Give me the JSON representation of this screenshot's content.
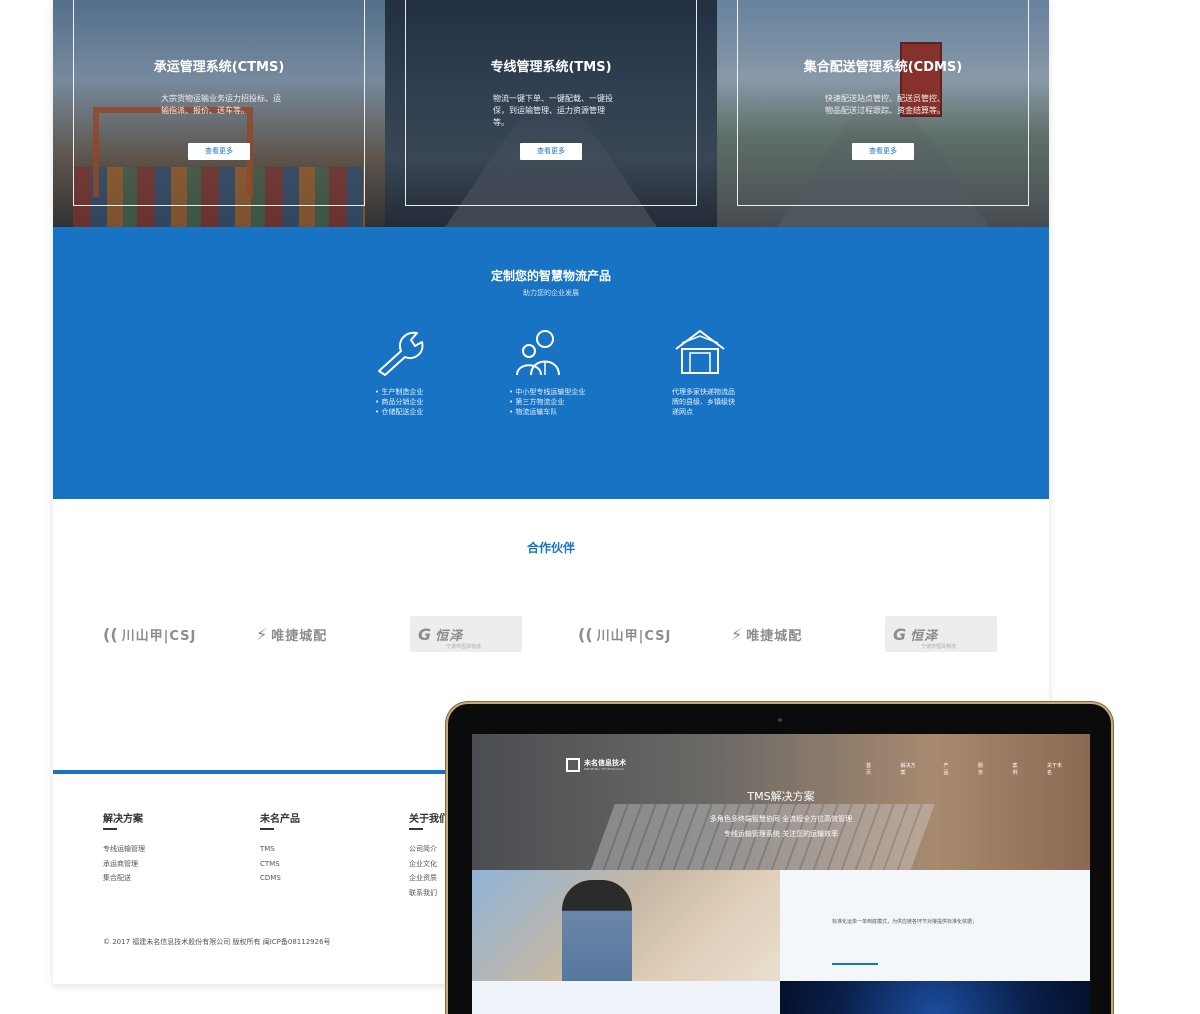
{
  "hero": {
    "panels": [
      {
        "title": "承运管理系统(CTMS)",
        "desc": "大宗货物运输业务运力招投标、运输指派、报价、送车等。",
        "button": "查看更多"
      },
      {
        "title": "专线管理系统(TMS)",
        "desc": "物流一键下单、一键配载、一键投保，到运输管理、运力资源管理等。",
        "button": "查看更多"
      },
      {
        "title": "集合配送管理系统(CDMS)",
        "desc": "快速配送站点管控、配送员管控、物品配送过程跟踪、资金结算等。",
        "button": "查看更多"
      }
    ]
  },
  "custom": {
    "title": "定制您的智慧物流产品",
    "subtitle": "助力您的企业发展",
    "columns": [
      {
        "icon": "wrench-icon",
        "items": [
          "生产制造企业",
          "商品分销企业",
          "仓储配送企业"
        ]
      },
      {
        "icon": "people-icon",
        "items": [
          "中小型专线运输型企业",
          "第三方物流企业",
          "物流运输车队"
        ]
      },
      {
        "icon": "house-icon",
        "text": "代理多家快递物流品牌的县级、乡镇级快递网点"
      }
    ]
  },
  "partners": {
    "title": "合作伙伴",
    "logos": [
      {
        "mark": "((",
        "name": "川山甲|CSJ"
      },
      {
        "mark": "⚡",
        "name": "唯捷城配"
      },
      {
        "mark": "G",
        "name": "恒泽",
        "sub": "宁波市恒泽物流"
      },
      {
        "mark": "((",
        "name": "川山甲|CSJ"
      },
      {
        "mark": "⚡",
        "name": "唯捷城配"
      },
      {
        "mark": "G",
        "name": "恒泽",
        "sub": "宁波市恒泽物流"
      }
    ]
  },
  "footer": {
    "columns": [
      {
        "title": "解决方案",
        "items": [
          "专线运输管理",
          "承运商管理",
          "集合配送"
        ]
      },
      {
        "title": "未名产品",
        "items": [
          "TMS",
          "CTMS",
          "CDMS"
        ]
      },
      {
        "title": "关于我们",
        "items": [
          "公司简介",
          "企业文化",
          "企业资质",
          "联系我们"
        ]
      }
    ],
    "copyright": "© 2017 福建未名信息技术股份有限公司 版权所有 闽ICP备08112926号"
  },
  "monitor": {
    "logo_name": "未名信息技术",
    "logo_en": "WEIMING TECHNOLOGY",
    "nav": [
      "首页",
      "解决方案",
      "产品",
      "服务",
      "案例",
      "关于未名"
    ],
    "hero_title": "TMS解决方案",
    "hero_line1": "多角色多终端智慧协同  全流程全方位高效管理",
    "hero_line2": "专线运输管理系统  关注您的运输效率",
    "content_text": "标准化运单一单到底模式，为供应链各环节对接提供标准化依据；"
  },
  "colors": {
    "brand_blue": "#1873c4",
    "bezel_gold": "#c7a97a"
  }
}
